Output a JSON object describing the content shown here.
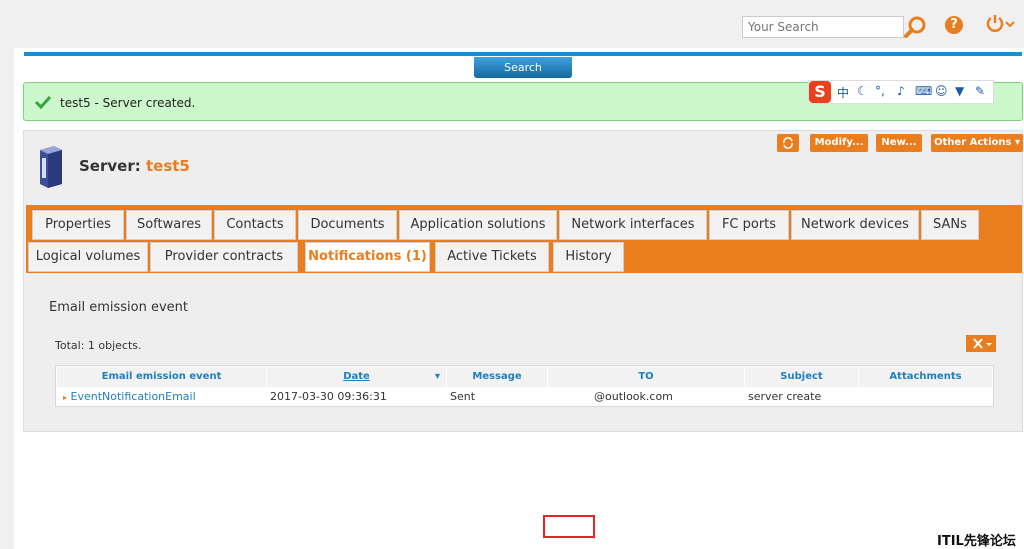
{
  "header": {
    "search_placeholder": "Your Search",
    "help_label": "?"
  },
  "search_button": "Search",
  "message": "test5 - Server created.",
  "ime": {
    "logo": "S",
    "mode": "中"
  },
  "object": {
    "type_label": "Server:",
    "name": "test5"
  },
  "actions": {
    "refresh": "refresh-icon",
    "modify": "Modify...",
    "new": "New...",
    "other": "Other Actions"
  },
  "tabs": {
    "row1": [
      "Properties",
      "Softwares",
      "Contacts",
      "Documents",
      "Application solutions",
      "Network interfaces",
      "FC ports",
      "Network devices",
      "SANs"
    ],
    "row2": [
      "Logical volumes",
      "Provider contracts",
      "Notifications (1)",
      "Active Tickets",
      "History"
    ],
    "active": "Notifications (1)"
  },
  "section_title": "Email emission event",
  "total": "Total: 1 objects.",
  "table": {
    "columns": [
      "Email emission event",
      "Date",
      "Message",
      "TO",
      "Subject",
      "Attachments"
    ],
    "rows": [
      [
        "EventNotificationEmail",
        "2017-03-30 09:36:31",
        "Sent",
        "@outlook.com",
        "server create",
        ""
      ]
    ]
  },
  "watermark": "ITIL先锋论坛",
  "colors": {
    "accent": "#ea7d1e",
    "link": "#1e7fbf",
    "success_bg": "#ccf7cc",
    "rule": "#1b8fd5"
  }
}
